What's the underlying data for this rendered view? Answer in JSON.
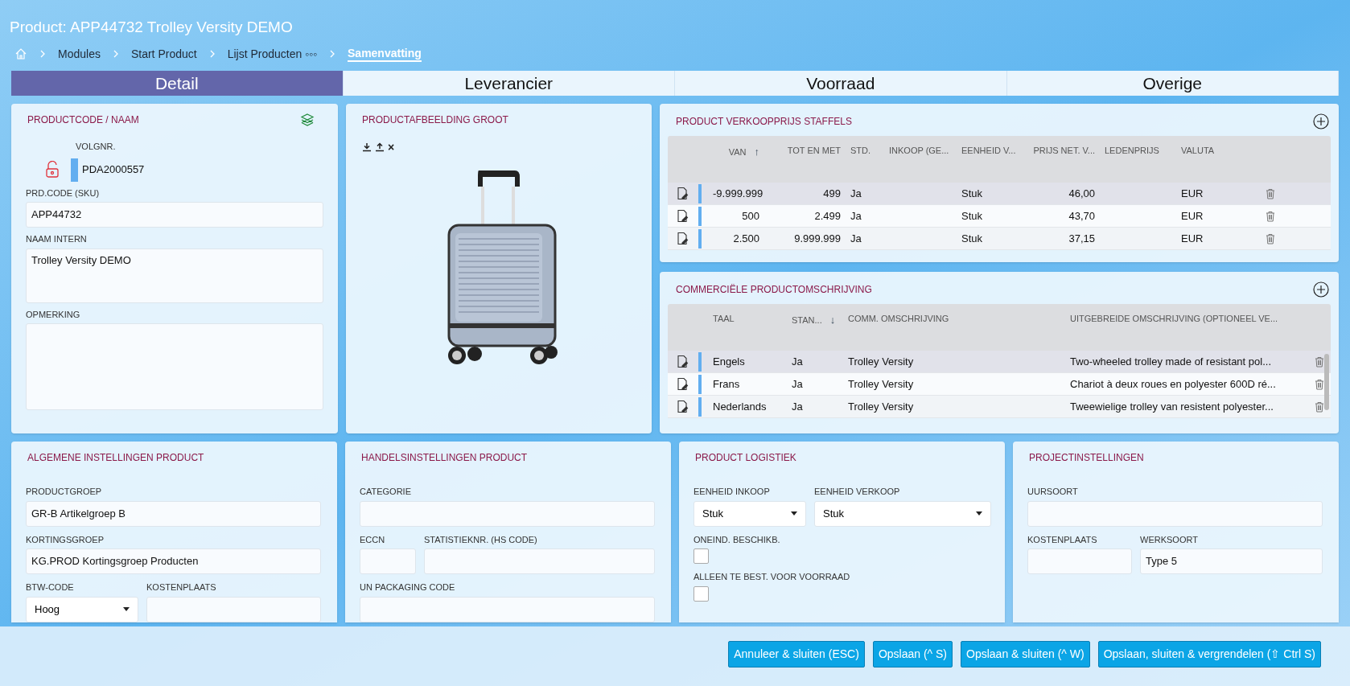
{
  "title": "Product: APP44732 Trolley Versity DEMO",
  "breadcrumb": [
    {
      "label": "Modules",
      "current": false
    },
    {
      "label": "Start Product",
      "current": false
    },
    {
      "label": "Lijst Producten ◦◦◦",
      "current": false
    },
    {
      "label": "Samenvatting",
      "current": true
    }
  ],
  "tabs": [
    {
      "label": "Detail",
      "selected": true
    },
    {
      "label": "Leverancier",
      "selected": false
    },
    {
      "label": "Voorraad",
      "selected": false
    },
    {
      "label": "Overige",
      "selected": false
    }
  ],
  "product_panel": {
    "title": "PRODUCTCODE / NAAM",
    "locked": false,
    "volgnr_label": "VOLGNR.",
    "volgnr": "PDA2000557",
    "fields": [
      {
        "label": "PRD.CODE (SKU)",
        "value": "APP44732",
        "kind": "text"
      },
      {
        "label": "NAAM INTERN",
        "value": "Trolley Versity DEMO",
        "kind": "textarea"
      },
      {
        "label": "OPMERKING",
        "kind": "bigarea"
      }
    ]
  },
  "image_panel": {
    "title": "PRODUCTAFBEELDING GROOT",
    "remove_icon": "×"
  },
  "price_panel": {
    "title": "PRODUCT VERKOOPPRIJS STAFFELS",
    "columns": [
      {
        "label": "VAN",
        "sort_arrow": "↑",
        "kind": "number"
      },
      {
        "label": "TOT EN MET",
        "kind": "number"
      },
      {
        "label": "STD.",
        "kind": "text"
      },
      {
        "label": "INKOOP (GE...",
        "kind": "text"
      },
      {
        "label": "EENHEID V...",
        "kind": "text"
      },
      {
        "label": "PRIJS NET. V...",
        "kind": "number"
      },
      {
        "label": "LEDENPRIJS",
        "kind": "text"
      },
      {
        "label": "VALUTA",
        "kind": "text"
      }
    ],
    "rows": [
      {
        "selected": true,
        "cells": [
          "-9.999.999",
          "499",
          "Ja",
          null,
          "Stuk",
          "46,00",
          null,
          "EUR"
        ]
      },
      {
        "selected": false,
        "cells": [
          "500",
          "2.499",
          "Ja",
          null,
          "Stuk",
          "43,70",
          null,
          "EUR"
        ]
      },
      {
        "selected": false,
        "cells": [
          "2.500",
          "9.999.999",
          "Ja",
          null,
          "Stuk",
          "37,15",
          null,
          "EUR"
        ]
      }
    ]
  },
  "desc_panel": {
    "title": "COMMERCIËLE PRODUCTOMSCHRIJVING",
    "columns": [
      {
        "label": "TAAL",
        "kind": "text"
      },
      {
        "label": "STAN...",
        "sort_arrow": "↓",
        "kind": "text"
      },
      {
        "label": "COMM. OMSCHRIJVING",
        "kind": "text"
      },
      {
        "label": "UITGEBREIDE OMSCHRIJVING (OPTIONEEL VE...",
        "kind": "text"
      }
    ],
    "rows": [
      {
        "selected": true,
        "cells": [
          "Engels",
          "Ja",
          "Trolley Versity",
          "Two-wheeled trolley made of resistant pol..."
        ]
      },
      {
        "selected": false,
        "cells": [
          "Frans",
          "Ja",
          "Trolley Versity",
          "Chariot à deux roues en polyester 600D ré..."
        ]
      },
      {
        "selected": false,
        "cells": [
          "Nederlands",
          "Ja",
          "Trolley Versity",
          "Tweewielige trolley van resistent polyester..."
        ]
      }
    ]
  },
  "settings_panels": [
    {
      "title": "ALGEMENE INSTELLINGEN PRODUCT",
      "rows": [
        [
          {
            "label": "PRODUCTGROEP",
            "value": "GR-B Artikelgroep B",
            "kind": "text"
          }
        ],
        [
          {
            "label": "KORTINGSGROEP",
            "value": "KG.PROD Kortingsgroep Producten",
            "kind": "text"
          }
        ],
        [
          {
            "label": "BTW-CODE",
            "value": "Hoog",
            "kind": "select"
          },
          {
            "label": "KOSTENPLAATS",
            "kind": "text"
          }
        ]
      ]
    },
    {
      "title": "HANDELSINSTELLINGEN PRODUCT",
      "rows": [
        [
          {
            "label": "CATEGORIE",
            "kind": "text"
          }
        ],
        [
          {
            "label": "ECCN",
            "kind": "text"
          },
          {
            "label": "STATISTIEKNR. (HS CODE)",
            "kind": "text"
          }
        ],
        [
          {
            "label": "UN PACKAGING CODE",
            "kind": "text"
          }
        ]
      ]
    },
    {
      "title": "PRODUCT LOGISTIEK",
      "rows": [
        [
          {
            "label": "EENHEID INKOOP",
            "value": "Stuk",
            "kind": "select"
          },
          {
            "label": "EENHEID VERKOOP",
            "value": "Stuk",
            "kind": "select"
          }
        ],
        [
          {
            "label": "ONEIND. BESCHIKB.",
            "checked": false,
            "kind": "checkbox"
          }
        ],
        [
          {
            "label": "ALLEEN TE BEST. VOOR VOORRAAD",
            "checked": false,
            "kind": "checkbox"
          }
        ]
      ]
    },
    {
      "title": "PROJECTINSTELLINGEN",
      "rows": [
        [
          {
            "label": "UURSOORT",
            "kind": "text"
          }
        ],
        [
          {
            "label": "KOSTENPLAATS",
            "kind": "text"
          },
          {
            "label": "WERKSOORT",
            "value": "Type 5",
            "kind": "text"
          }
        ]
      ]
    }
  ],
  "buttons": [
    "Annuleer & sluiten (ESC)",
    "Opslaan (^ S)",
    "Opslaan & sluiten (^ W)",
    "Opslaan, sluiten & vergrendelen (⇧ Ctrl S)"
  ]
}
